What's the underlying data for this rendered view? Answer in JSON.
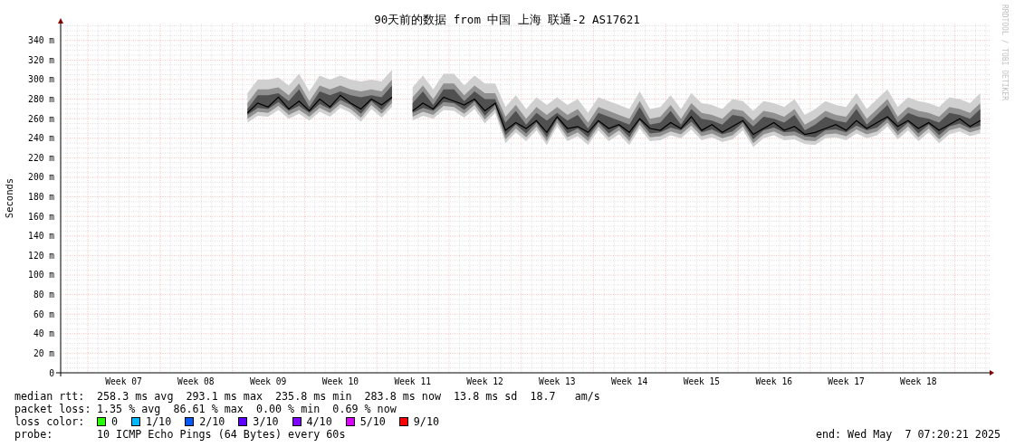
{
  "graph": {
    "side_credit": "RRDTOOL / TOBI OETIKER",
    "chart_data": {
      "type": "line",
      "grid": true,
      "title": "90天前的数据 from 中国 上海 联通-2 AS17621",
      "ylabel": "Seconds",
      "ylim": [
        0,
        357
      ],
      "categories": [
        null,
        null,
        null,
        null,
        null,
        null,
        "Week 07",
        null,
        null,
        null,
        null,
        null,
        null,
        "Week 08",
        null,
        null,
        null,
        null,
        null,
        null,
        "Week 09",
        null,
        null,
        null,
        null,
        null,
        null,
        "Week 10",
        null,
        null,
        null,
        null,
        null,
        null,
        "Week 11",
        null,
        null,
        null,
        null,
        null,
        null,
        "Week 12",
        null,
        null,
        null,
        null,
        null,
        null,
        "Week 13",
        null,
        null,
        null,
        null,
        null,
        null,
        "Week 14",
        null,
        null,
        null,
        null,
        null,
        null,
        "Week 15",
        null,
        null,
        null,
        null,
        null,
        null,
        "Week 16",
        null,
        null,
        null,
        null,
        null,
        null,
        "Week 17",
        null,
        null,
        null,
        null,
        null,
        null,
        "Week 18",
        null,
        null,
        null,
        null,
        null,
        null
      ],
      "yticks": [
        {
          "value": 0,
          "label": "0"
        },
        {
          "value": 20,
          "label": "20 m"
        },
        {
          "value": 40,
          "label": "40 m"
        },
        {
          "value": 60,
          "label": "60 m"
        },
        {
          "value": 80,
          "label": "80 m"
        },
        {
          "value": 100,
          "label": "100 m"
        },
        {
          "value": 120,
          "label": "120 m"
        },
        {
          "value": 140,
          "label": "140 m"
        },
        {
          "value": 160,
          "label": "160 m"
        },
        {
          "value": 180,
          "label": "180 m"
        },
        {
          "value": 200,
          "label": "200 m"
        },
        {
          "value": 220,
          "label": "220 m"
        },
        {
          "value": 240,
          "label": "240 m"
        },
        {
          "value": 260,
          "label": "260 m"
        },
        {
          "value": 280,
          "label": "280 m"
        },
        {
          "value": 300,
          "label": "300 m"
        },
        {
          "value": 320,
          "label": "320 m"
        },
        {
          "value": 340,
          "label": "340 m"
        }
      ],
      "series": [
        {
          "color": "#000000",
          "values": [
            null,
            null,
            null,
            null,
            null,
            null,
            null,
            null,
            null,
            null,
            null,
            null,
            null,
            null,
            null,
            null,
            null,
            null,
            266,
            276,
            272,
            282,
            270,
            278,
            268,
            280,
            272,
            284,
            276,
            270,
            280,
            274,
            282,
            null,
            268,
            276,
            270,
            282,
            278,
            274,
            280,
            268,
            276,
            248,
            256,
            250,
            258,
            246,
            262,
            250,
            252,
            246,
            258,
            250,
            254,
            246,
            260,
            250,
            248,
            256,
            250,
            262,
            248,
            254,
            246,
            252,
            258,
            244,
            250,
            256,
            248,
            252,
            244,
            246,
            250,
            254,
            248,
            258,
            250,
            256,
            262,
            252,
            258,
            250,
            256,
            248,
            254,
            260,
            252,
            258
          ]
        }
      ]
    }
  },
  "stats": [
    {
      "label": "median rtt:",
      "value": "258.3 ms avg  293.1 ms max  235.8 ms min  283.8 ms now  13.8 ms sd  18.7   am/s"
    },
    {
      "label": "packet loss:",
      "value": "1.35 % avg  86.61 % max  0.00 % min  0.69 % now"
    }
  ],
  "loss_legend": {
    "label": "loss color:",
    "items": [
      {
        "label": "0",
        "color": "#26ff00"
      },
      {
        "label": "1/10",
        "color": "#00b8ff"
      },
      {
        "label": "2/10",
        "color": "#0059ff"
      },
      {
        "label": "3/10",
        "color": "#5e00ff"
      },
      {
        "label": "4/10",
        "color": "#7e00ff"
      },
      {
        "label": "5/10",
        "color": "#dd00ff"
      },
      {
        "label": "9/10",
        "color": "#ff0000"
      }
    ]
  },
  "probe": {
    "label": "probe:",
    "value": "10 ICMP Echo Pings (64 Bytes) every 60s"
  },
  "end": "end: Wed May  7 07:20:21 2025"
}
